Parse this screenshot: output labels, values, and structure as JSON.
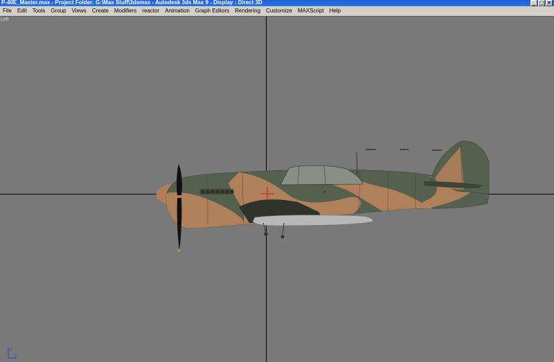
{
  "window": {
    "title": "P-40E_Master.max     - Project Folder: G:\\Max Stuff\\3dsmax     - Autodesk 3ds Max 9       - Display : Direct 3D",
    "buttons": [
      "_",
      "□",
      "×"
    ]
  },
  "menu": {
    "items": [
      "File",
      "Edit",
      "Tools",
      "Group",
      "Views",
      "Create",
      "Modifiers",
      "reactor",
      "Animation",
      "Graph Editors",
      "Rendering",
      "Customize",
      "MAXScript",
      "Help"
    ]
  },
  "viewport": {
    "label": "Left",
    "background": "#797979",
    "grid_color": "#000000"
  },
  "model": {
    "camo_green": "#56604f",
    "camo_tan": "#b0805a"
  }
}
